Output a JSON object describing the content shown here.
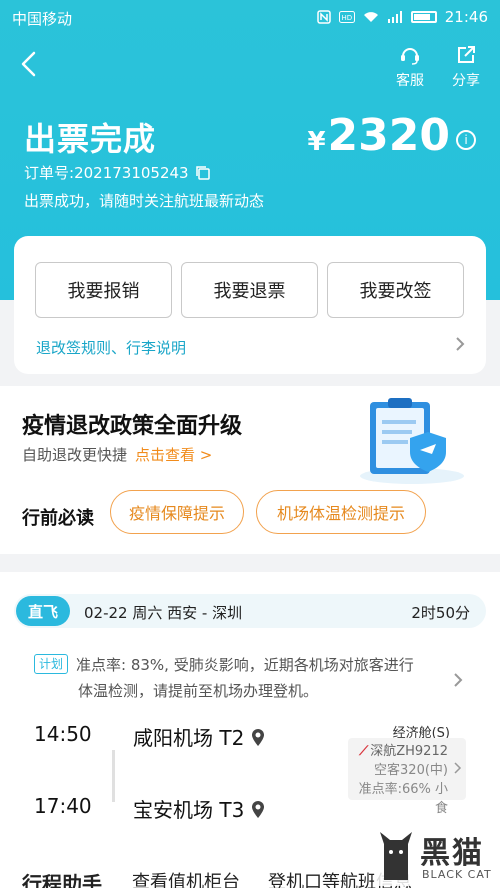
{
  "status_bar": {
    "carrier": "中国移动",
    "time": "21:46",
    "icons": [
      "nfc-icon",
      "hd-icon",
      "wifi-icon",
      "signal-icon",
      "battery-icon"
    ]
  },
  "header": {
    "customer_service": "客服",
    "share": "分享",
    "title": "出票完成",
    "currency": "¥",
    "price": "2320",
    "order_label": "订单号:",
    "order_no": "202173105243",
    "subtitle": "出票成功，请随时关注航班最新动态"
  },
  "actions": {
    "reimburse": "我要报销",
    "refund": "我要退票",
    "change": "我要改签",
    "rules_link": "退改签规则、行李说明"
  },
  "promo": {
    "title": "疫情退改政策全面升级",
    "desc": "自助退改更快捷",
    "link": "点击查看 >",
    "must_read": "行前必读",
    "pill1": "疫情保障提示",
    "pill2": "机场体温检测提示"
  },
  "flight": {
    "tag": "直飞",
    "route": "02-22  周六  西安 - 深圳",
    "duration": "2时50分",
    "plan_tag": "计划",
    "notice_line1": "准点率: 83%, 受肺炎影响，近期各机场对旅客进行",
    "notice_line2": "体温检测，请提前至机场办理登机。",
    "dep_time": "14:50",
    "dep_airport": "咸阳机场 T2",
    "arr_time": "17:40",
    "arr_airport": "宝安机场 T3",
    "cabin": "经济舱(S)",
    "airline": "深航ZH9212",
    "aircraft": "空客320(中)",
    "punctuality": "准点率:66% 小食"
  },
  "bottom_tabs": {
    "tab1": "行程助手",
    "tab2": "查看值机柜台",
    "tab3": "登机口等航班信息"
  },
  "watermark": {
    "big": "黑猫",
    "small": "BLACK CAT"
  },
  "colors": {
    "brand": "#2bc3d9",
    "accent_orange": "#f18b1b",
    "link_blue": "#1aa6c8"
  }
}
